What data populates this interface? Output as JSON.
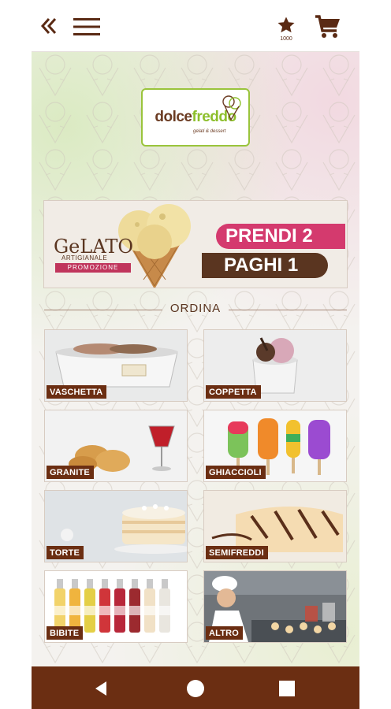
{
  "appbar": {
    "back_icon": "double-chevron-left-icon",
    "menu_icon": "hamburger-menu-icon",
    "favorites_icon": "star-icon",
    "favorites_count": "1000",
    "cart_icon": "shopping-cart-icon"
  },
  "logo": {
    "word_part1": "dolce",
    "word_part2": "freddo",
    "tagline": "gelati & dessert"
  },
  "promo": {
    "brand": "GeLATO",
    "brand_sub": "ARTIGIANALE",
    "badge": "PROMOZIONE",
    "line1": "PRENDI 2",
    "line2": "PAGHI 1"
  },
  "section_title": "ORDINA",
  "categories": [
    {
      "label": "VASCHETTA"
    },
    {
      "label": "COPPETTA"
    },
    {
      "label": "GRANITE"
    },
    {
      "label": "GHIACCIOLI"
    },
    {
      "label": "TORTE"
    },
    {
      "label": "SEMIFREDDI"
    },
    {
      "label": "BIBITE"
    },
    {
      "label": "ALTRO"
    }
  ],
  "navbar": {
    "back_icon": "triangle-back-icon",
    "home_icon": "circle-home-icon",
    "recents_icon": "square-recents-icon"
  },
  "colors": {
    "brand_brown": "#6b2e12",
    "brand_green": "#8dbf2b",
    "promo_pink": "#d43a6e"
  }
}
